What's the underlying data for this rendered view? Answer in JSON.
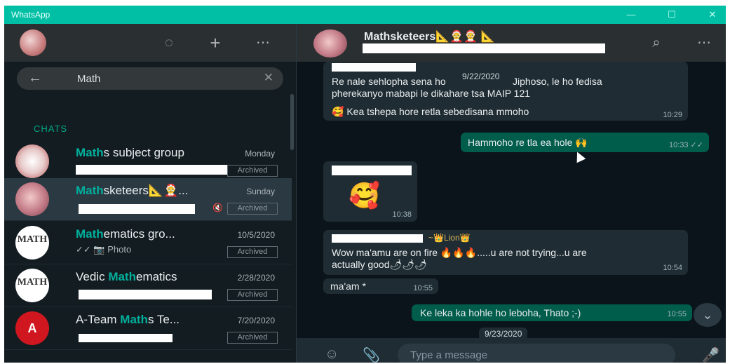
{
  "window": {
    "title": "WhatsApp",
    "minimize": "—",
    "maximize": "☐",
    "close": "✕"
  },
  "sidebar_header": {
    "icons": [
      "status-icon",
      "new-chat-icon",
      "menu-icon"
    ]
  },
  "search": {
    "query": "Math",
    "back": "←",
    "clear": "✕"
  },
  "section_label": "CHATS",
  "chats": [
    {
      "name_hl": "Math",
      "name_rest": "s subject group",
      "date": "Monday",
      "badge": "Archived"
    },
    {
      "name_hl": "Math",
      "name_rest": "sketeers📐🤶...",
      "date": "Sunday",
      "badge": "Archived",
      "muted": "🔇"
    },
    {
      "name_hl": "Math",
      "name_rest": "ematics gro...",
      "date": "10/5/2020",
      "badge": "Archived",
      "sub": "✓✓ 📷 Photo"
    },
    {
      "name_pre": "Vedic ",
      "name_hl": "Math",
      "name_rest": "ematics",
      "date": "2/28/2020",
      "badge": "Archived"
    },
    {
      "name_pre": "A-Team ",
      "name_hl": "Math",
      "name_rest": "s Te...",
      "date": "7/20/2020",
      "badge": "Archived"
    }
  ],
  "conversation": {
    "title": "Mathsketeers📐🤶🤶 📐",
    "messages": {
      "m1_line1": "Re nale sehlopha sena ho",
      "m1_line1b": "Jiphoso, le ho fedisa",
      "m1_line2": "pherekanyo mabapi le dikahare tsa MAIP 121",
      "m1_line3": "🥰 Kea tshepa hore retla sebedisana mmoho",
      "m1_time": "10:29",
      "date1": "9/22/2020",
      "m2": "Hammoho re tla ea hole 🙌",
      "m2_time": "10:33 ✓✓",
      "m3_emoji": "🥰",
      "m3_time": "10:38",
      "m4_sender": "~👑Lion👑",
      "m4_line1": "Wow ma'amu are on fire 🔥🔥🔥.....u are not trying...u are",
      "m4_line2": "actually good🌶🌶🌶",
      "m4_time": "10:54",
      "m5": "ma'am *",
      "m5_time": "10:55",
      "m6": "Ke leka ka hohle ho leboha, Thato ;-)",
      "m6_time": "10:55",
      "date2": "9/23/2020"
    },
    "composer_placeholder": "Type a message"
  }
}
